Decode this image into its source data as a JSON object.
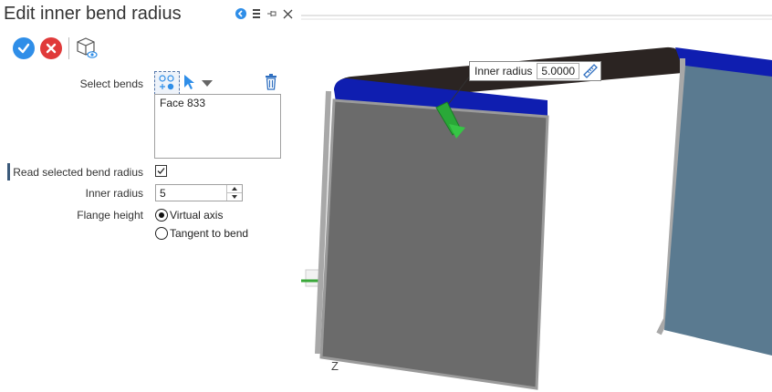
{
  "panel": {
    "title": "Edit inner bend radius",
    "header_icons": {
      "collapse": "collapse-icon",
      "menu": "menu-icon",
      "pin": "pin-icon",
      "close": "close-icon"
    },
    "accept_icon": "check-icon",
    "cancel_icon": "x-icon",
    "preview_icon": "preview-icon",
    "select_bends_label": "Select bends",
    "bends_list": [
      "Face 833"
    ],
    "read_selected_label": "Read selected bend radius",
    "read_selected_checked": true,
    "inner_radius_label": "Inner radius",
    "inner_radius_value": "5",
    "flange_height_label": "Flange height",
    "flange_options": [
      {
        "label": "Virtual axis",
        "selected": true
      },
      {
        "label": "Tangent to bend",
        "selected": false
      }
    ]
  },
  "viewport": {
    "tooltip_label": "Inner radius",
    "tooltip_value": "5.0000",
    "axis_label": "Z"
  },
  "colors": {
    "accept": "#2f8ee8",
    "cancel": "#e03a3a",
    "accent_bar": "#3b5a7a",
    "flange_front": "#6b6b6b",
    "bend_blue": "#0f1eb0",
    "top_dark": "#2b2422",
    "right_face": "#5a7a90",
    "arrow_green": "#2aa838"
  }
}
